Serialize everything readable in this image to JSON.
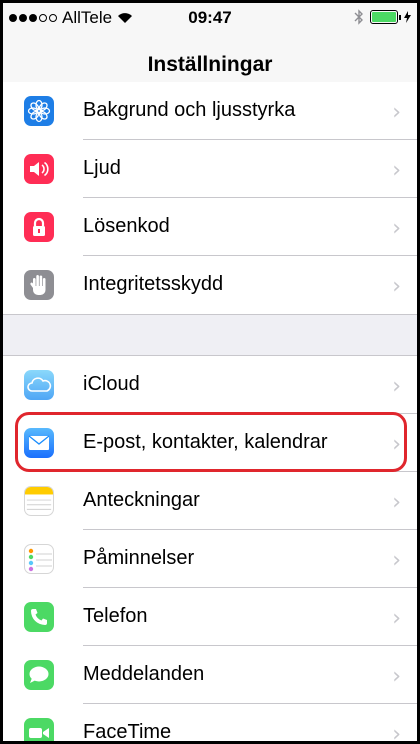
{
  "status_bar": {
    "carrier": "AllTele",
    "time": "09:47",
    "signal_bars_filled": 3,
    "signal_bars_total": 5
  },
  "navigation": {
    "title": "Inställningar"
  },
  "settings_group_1": [
    {
      "label": "Bakgrund och ljusstyrka",
      "icon": "flower-icon"
    },
    {
      "label": "Ljud",
      "icon": "speaker-icon"
    },
    {
      "label": "Lösenkod",
      "icon": "lock-icon"
    },
    {
      "label": "Integritetsskydd",
      "icon": "hand-icon"
    }
  ],
  "settings_group_2": [
    {
      "label": "iCloud",
      "icon": "cloud-icon"
    },
    {
      "label": "E-post, kontakter, kalendrar",
      "icon": "mail-icon",
      "highlighted": true
    },
    {
      "label": "Anteckningar",
      "icon": "notes-icon"
    },
    {
      "label": "Påminnelser",
      "icon": "reminders-icon"
    },
    {
      "label": "Telefon",
      "icon": "phone-icon"
    },
    {
      "label": "Meddelanden",
      "icon": "messages-icon"
    },
    {
      "label": "FaceTime",
      "icon": "facetime-icon"
    }
  ],
  "colors": {
    "highlight": "#e0262d",
    "wallpaper_icon": "#1e7ee6",
    "sound_icon": "#ff2d55",
    "passcode_icon": "#ff2d55",
    "privacy_icon": "#8e8e93",
    "icloud_icon": "#5ac8fa",
    "mail_icon": "#1a8dfd",
    "phone_icon": "#4cd964",
    "messages_icon": "#4cd964",
    "facetime_icon": "#4cd964"
  }
}
